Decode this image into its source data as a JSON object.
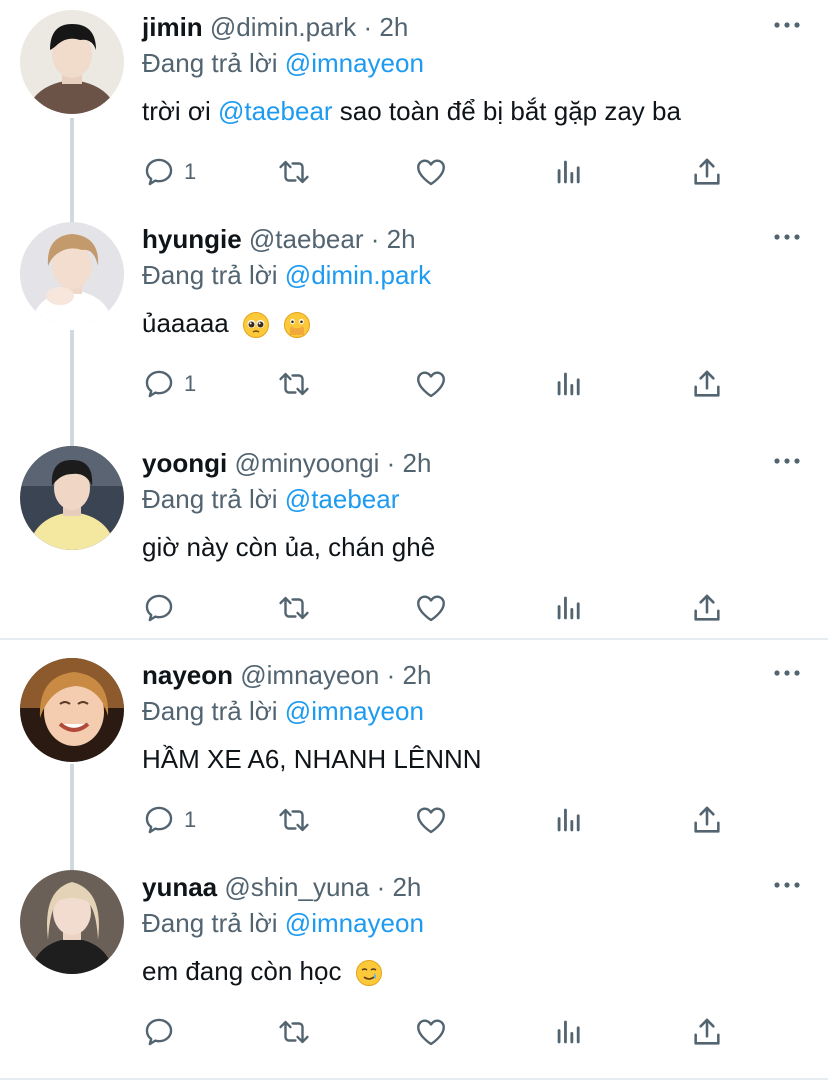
{
  "reply_prefix": "Đang trả lời",
  "tweets": [
    {
      "name": "jimin",
      "handle": "@dimin.park",
      "time": "2h",
      "reply_to": "@imnayeon",
      "text_before": "trời ơi ",
      "text_mention": "@taebear",
      "text_after": " sao toàn để bị bắt gặp zay ba",
      "reply_count": "1"
    },
    {
      "name": "hyungie",
      "handle": "@taebear",
      "time": "2h",
      "reply_to": "@dimin.park",
      "text": "ủaaaaa",
      "reply_count": "1",
      "emojis": [
        "pleading-face",
        "face-with-open-eyes-and-hand-over-mouth"
      ]
    },
    {
      "name": "yoongi",
      "handle": "@minyoongi",
      "time": "2h",
      "reply_to": "@taebear",
      "text": "giờ này còn ủa, chán ghê",
      "reply_count": ""
    },
    {
      "name": "nayeon",
      "handle": "@imnayeon",
      "time": "2h",
      "reply_to": "@imnayeon",
      "text": "HẦM XE A6, NHANH LÊNNN",
      "reply_count": "1"
    },
    {
      "name": "yunaa",
      "handle": "@shin_yuna",
      "time": "2h",
      "reply_to": "@imnayeon",
      "text": "em đang còn học",
      "reply_count": "",
      "emojis": [
        "smiling-face-with-tear"
      ]
    }
  ],
  "icons": [
    "reply-icon",
    "retweet-icon",
    "like-icon",
    "analytics-icon",
    "share-icon",
    "more-icon"
  ],
  "colors": {
    "link": "#1d9bf0",
    "secondary": "#536471",
    "primary": "#0f1419"
  }
}
